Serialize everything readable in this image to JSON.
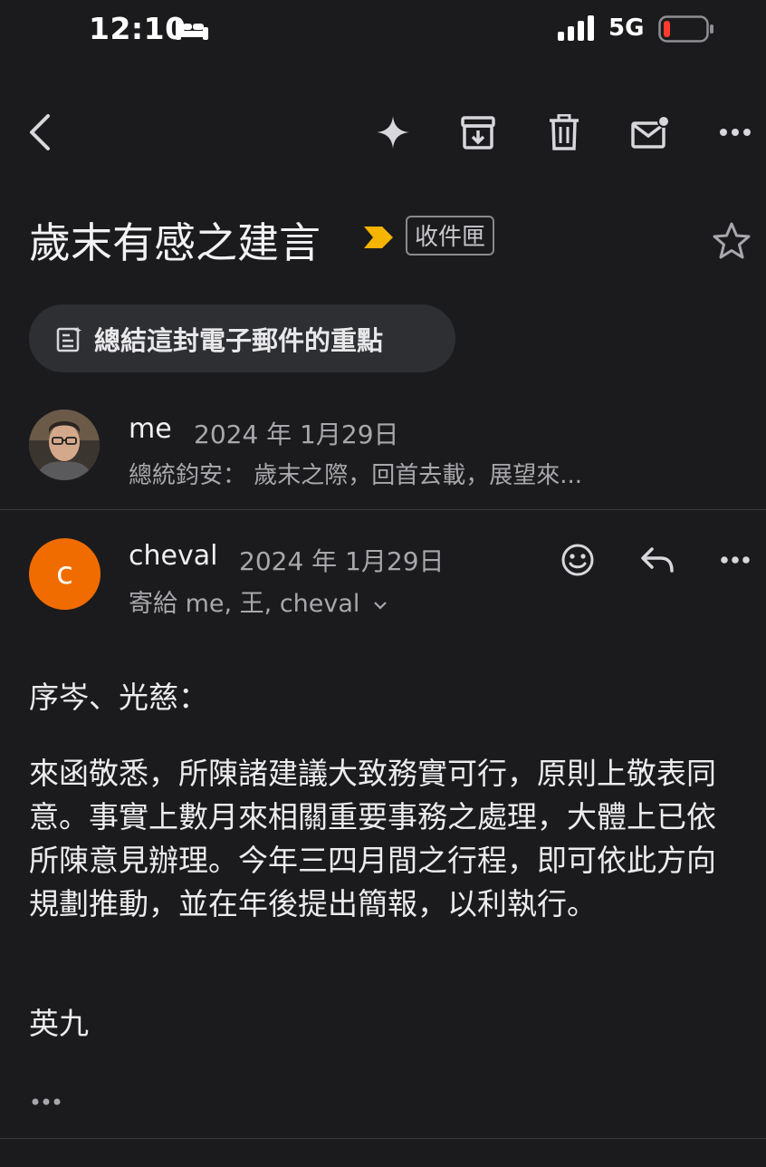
{
  "status_bar": {
    "time": "12:10",
    "sleep_icon": "bed-icon",
    "network": "5G",
    "battery_low_color": "#ff3b30"
  },
  "toolbar": {
    "icons": [
      "back-arrow-icon",
      "sparkle-icon",
      "archive-icon",
      "trash-icon",
      "mark-unread-icon",
      "more-icon"
    ]
  },
  "subject": {
    "title": "歲末有感之建言",
    "importance_color": "#f4b400",
    "label": "收件匣"
  },
  "summarize": {
    "label": "總結這封電子郵件的重點"
  },
  "messages": [
    {
      "sender": "me",
      "date": "2024 年 1月29日",
      "snippet": "總統鈞安：  歲末之際，回首去載，展望來..."
    },
    {
      "sender": "cheval",
      "avatar_letter": "c",
      "avatar_color": "#f06c00",
      "date": "2024 年 1月29日",
      "recipients": "寄給 me, 王, cheval",
      "greeting": "序岑、光慈：",
      "body": "來函敬悉，所陳諸建議大致務實可行，原則上敬表同意。事實上數月來相關重要事務之處理，大體上已依所陳意見辦理。今年三四月間之行程，即可依此方向規劃推動，並在年後提出簡報，以利執行。",
      "signature": "英九"
    }
  ]
}
